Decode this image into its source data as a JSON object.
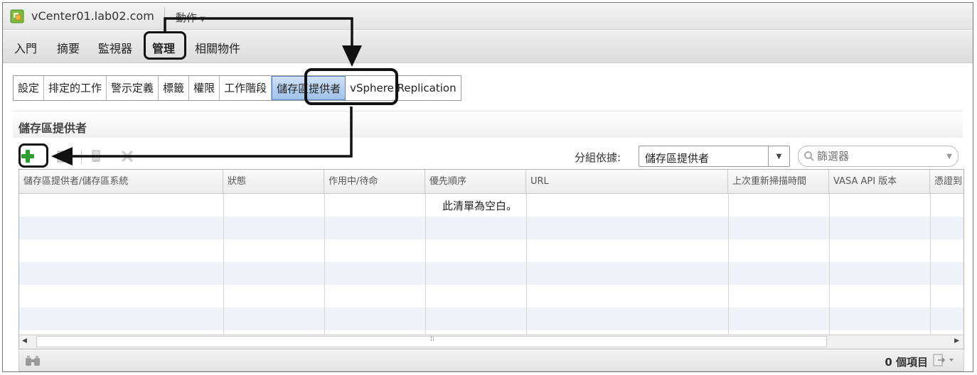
{
  "window": {
    "title": "vCenter01.lab02.com",
    "actions_label": "動作",
    "icons": {
      "app": "vcenter-icon",
      "caret": "chevron-down-icon"
    }
  },
  "top_tabs": [
    {
      "label": "入門"
    },
    {
      "label": "摘要"
    },
    {
      "label": "監視器"
    },
    {
      "label": "管理",
      "active": true
    },
    {
      "label": "相關物件"
    }
  ],
  "sub_tabs": [
    {
      "label": "設定"
    },
    {
      "label": "排定的工作"
    },
    {
      "label": "警示定義"
    },
    {
      "label": "標籤"
    },
    {
      "label": "權限"
    },
    {
      "label": "工作階段"
    },
    {
      "label": "儲存區提供者",
      "active": true
    },
    {
      "label": "vSphere Replication"
    }
  ],
  "section": {
    "title": "儲存區提供者"
  },
  "toolbar": {
    "add_icon": "plus-icon",
    "edit_icon": "edit-icon",
    "copy_icon": "copy-icon",
    "delete_icon": "delete-icon",
    "group_by_label": "分組依據:",
    "group_by_value": "儲存區提供者",
    "filter_placeholder": "篩選器"
  },
  "grid": {
    "columns": [
      "儲存區提供者/儲存區系統",
      "狀態",
      "作用中/待命",
      "優先順序",
      "URL",
      "上次重新掃描時間",
      "VASA API 版本",
      "憑證到"
    ],
    "empty_message": "此清單為空白。"
  },
  "footer": {
    "item_count": "0 個項目",
    "find_icon": "binoculars-icon",
    "export_icon": "export-icon"
  },
  "colors": {
    "active_tab": "#9fc2ea",
    "add_green": "#2e9e2e",
    "row_alt": "#eef3fa"
  }
}
